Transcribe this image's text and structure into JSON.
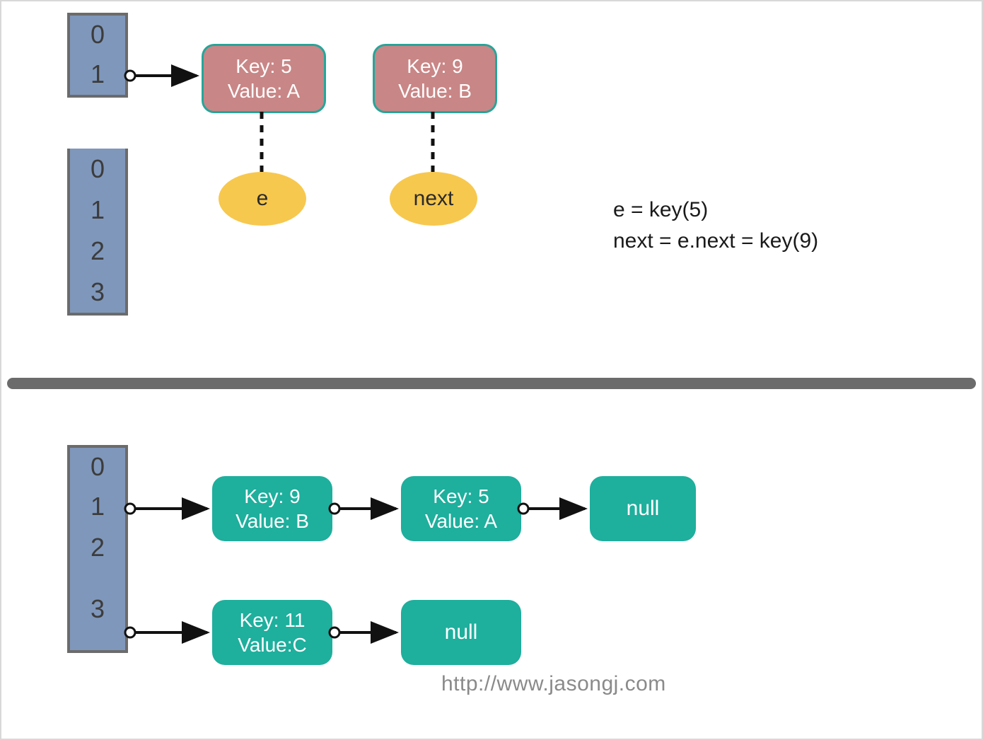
{
  "colors": {
    "cell_fill": "#7f97bb",
    "cell_border": "#6b6b6b",
    "node_pink_fill": "#c98686",
    "node_pink_border": "#27a599",
    "node_teal_fill": "#1eaf9d",
    "oval_fill": "#f7c84e",
    "divider": "#6b6b6b",
    "arrow": "#111111"
  },
  "top": {
    "small_array": [
      "0",
      "1"
    ],
    "big_array": [
      "0",
      "1",
      "2",
      "3"
    ],
    "nodes": [
      {
        "key_line": "Key: 5",
        "value_line": "Value: A"
      },
      {
        "key_line": "Key: 9",
        "value_line": "Value: B"
      }
    ],
    "ovals": {
      "e": "e",
      "next": "next"
    },
    "annotation": {
      "line1": "e = key(5)",
      "line2": "next = e.next = key(9)"
    }
  },
  "bottom": {
    "array": [
      "0",
      "1",
      "2",
      "3"
    ],
    "row1": [
      {
        "key_line": "Key: 9",
        "value_line": "Value: B"
      },
      {
        "key_line": "Key: 5",
        "value_line": "Value: A"
      },
      {
        "null_label": "null"
      }
    ],
    "row3": [
      {
        "key_line": "Key: 11",
        "value_line": "Value:C"
      },
      {
        "null_label": "null"
      }
    ]
  },
  "watermark": "http://www.jasongj.com"
}
